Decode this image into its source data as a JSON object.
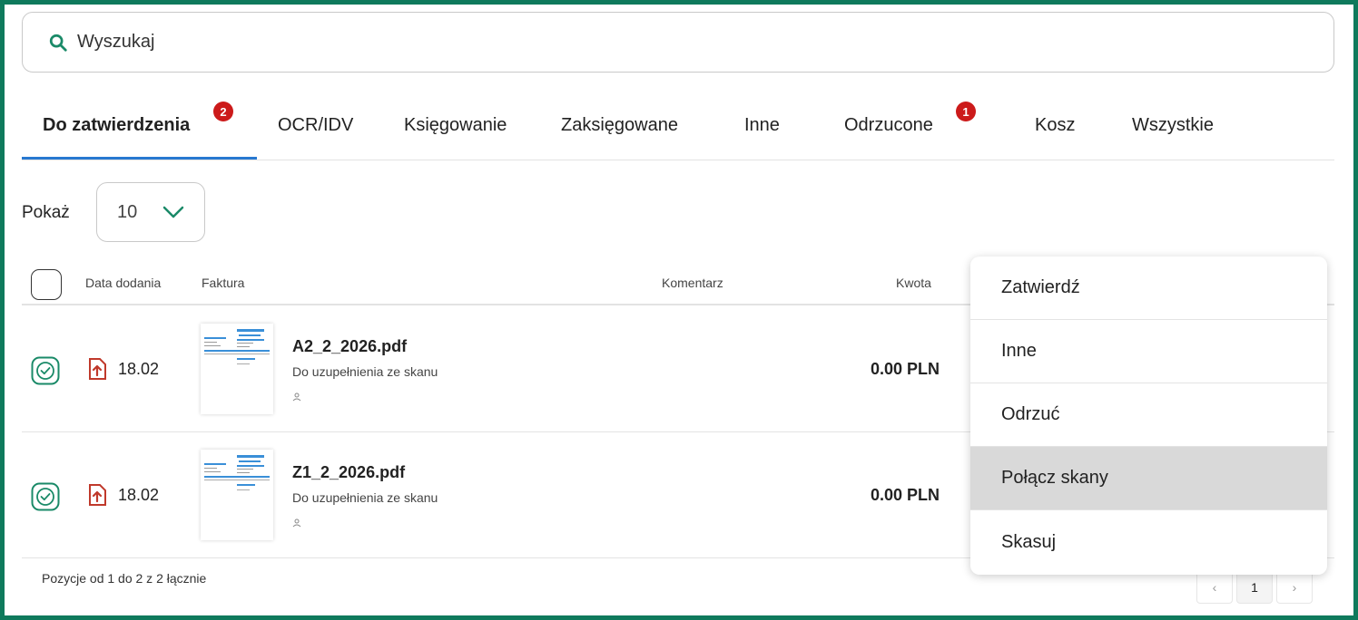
{
  "search": {
    "placeholder": "Wyszukaj",
    "icon": "search-icon"
  },
  "tabs": [
    {
      "label": "Do zatwierdzenia",
      "badge": "2",
      "active": true
    },
    {
      "label": "OCR/IDV"
    },
    {
      "label": "Księgowanie"
    },
    {
      "label": "Zaksięgowane"
    },
    {
      "label": "Inne"
    },
    {
      "label": "Odrzucone",
      "badge": "1"
    },
    {
      "label": "Kosz"
    },
    {
      "label": "Wszystkie"
    }
  ],
  "show": {
    "label": "Pokaż",
    "value": "10"
  },
  "table": {
    "headers": {
      "date": "Data dodania",
      "invoice": "Faktura",
      "comment": "Komentarz",
      "amount": "Kwota"
    },
    "rows": [
      {
        "date": "18.02",
        "filename": "A2_2_2026.pdf",
        "status": "Do uzupełnienia ze skanu",
        "amount": "0.00 PLN",
        "checked": true
      },
      {
        "date": "18.02",
        "filename": "Z1_2_2026.pdf",
        "status": "Do uzupełnienia ze skanu",
        "amount": "0.00 PLN",
        "checked": true
      }
    ],
    "footer": "Pozycje od 1 do 2 z 2 łącznie"
  },
  "pagination": {
    "prev": "‹",
    "current": "1",
    "next": "›"
  },
  "context_menu": {
    "items": [
      "Zatwierdź",
      "Inne",
      "Odrzuć",
      "Połącz skany",
      "Skasuj"
    ],
    "hovered": "Połącz skany"
  },
  "colors": {
    "frame": "#0f7a5c",
    "accent_green": "#1a8a68",
    "tab_underline": "#2878d0",
    "badge": "#cc1a1a",
    "pdf_icon": "#c0392b"
  }
}
